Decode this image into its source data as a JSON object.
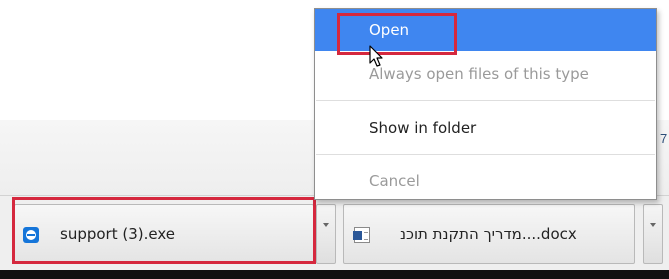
{
  "page": {
    "edge_glyph": "7"
  },
  "download_shelf": {
    "items": [
      {
        "file_name": "support (3).exe",
        "icon": "teamviewer-icon"
      },
      {
        "file_name": "מדריך התקנת תוכנ....docx",
        "icon": "word-document-icon"
      }
    ]
  },
  "context_menu": {
    "items": [
      {
        "label": "Open",
        "state": "highlighted"
      },
      {
        "label": "Always open files of this type",
        "state": "disabled"
      },
      {
        "label": "Show in folder",
        "state": "enabled"
      },
      {
        "label": "Cancel",
        "state": "disabled"
      }
    ]
  },
  "colors": {
    "menu_highlight": "#3f86f0",
    "annotation_box": "#d5283e",
    "disabled_text": "#9a9a9a",
    "shelf_background": "#efefef"
  },
  "cursor": "arrow-pointer-icon"
}
